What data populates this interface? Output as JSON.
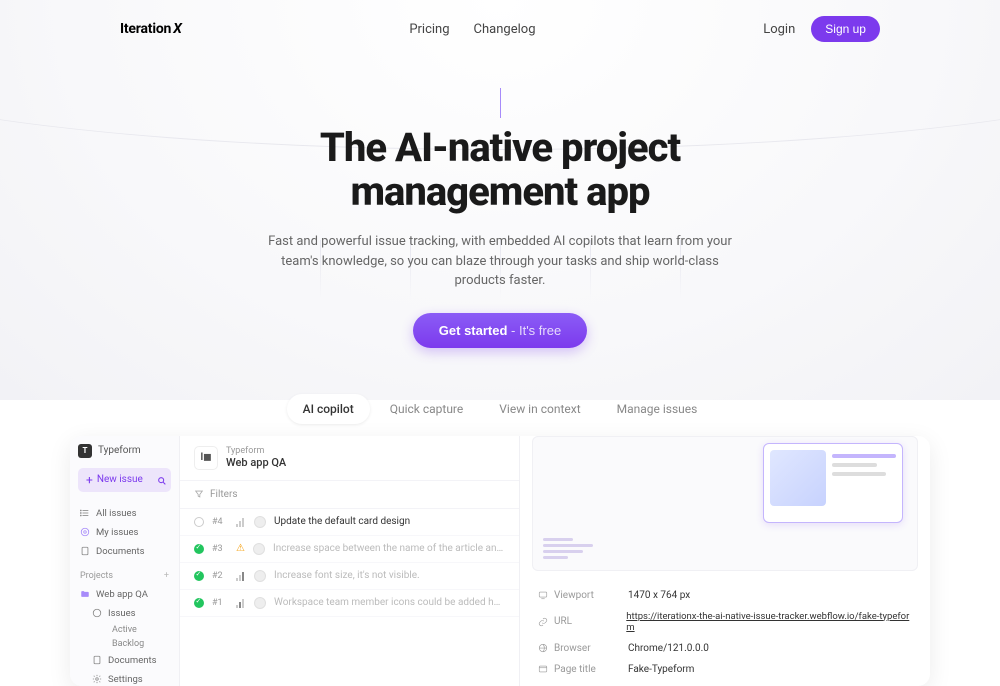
{
  "nav": {
    "logo": "Iteration",
    "logoX": "X",
    "pricing": "Pricing",
    "changelog": "Changelog",
    "login": "Login",
    "signup": "Sign up"
  },
  "hero": {
    "title1": "The AI-native project",
    "title2": "management app",
    "subtitle": "Fast and powerful issue tracking, with embedded AI copilots that learn from your team's knowledge, so you can blaze through your tasks and ship world-class products faster.",
    "cta_main": "Get started",
    "cta_sub": " - It's free"
  },
  "tabs": {
    "ai": "AI copilot",
    "capture": "Quick capture",
    "view": "View in context",
    "manage": "Manage issues"
  },
  "sidebar": {
    "workspace": "Typeform",
    "ws_initial": "T",
    "new_issue": "New issue",
    "all_issues": "All issues",
    "my_issues": "My issues",
    "documents": "Documents",
    "projects_label": "Projects",
    "project_name": "Web app QA",
    "issues": "Issues",
    "active": "Active",
    "backlog": "Backlog",
    "proj_documents": "Documents",
    "settings": "Settings"
  },
  "project": {
    "org": "Typeform",
    "name": "Web app QA",
    "filters": "Filters"
  },
  "issues": [
    {
      "id": "#4",
      "title": "Update the default card design",
      "status": "todo",
      "active": true
    },
    {
      "id": "#3",
      "title": "Increase space between the name of the article and the category",
      "status": "done",
      "active": false,
      "warn": true
    },
    {
      "id": "#2",
      "title": "Increase font size, it's not visible.",
      "status": "done",
      "active": false
    },
    {
      "id": "#1",
      "title": "Workspace team member icons could be added here for better UX?",
      "status": "done",
      "active": false
    }
  ],
  "meta": {
    "viewport_label": "Viewport",
    "viewport": "1470 x 764 px",
    "url_label": "URL",
    "url": "https://iterationx-the-ai-native-issue-tracker.webflow.io/fake-typeform",
    "browser_label": "Browser",
    "browser": "Chrome/121.0.0.0",
    "pagetitle_label": "Page title",
    "pagetitle": "Fake-Typeform"
  }
}
